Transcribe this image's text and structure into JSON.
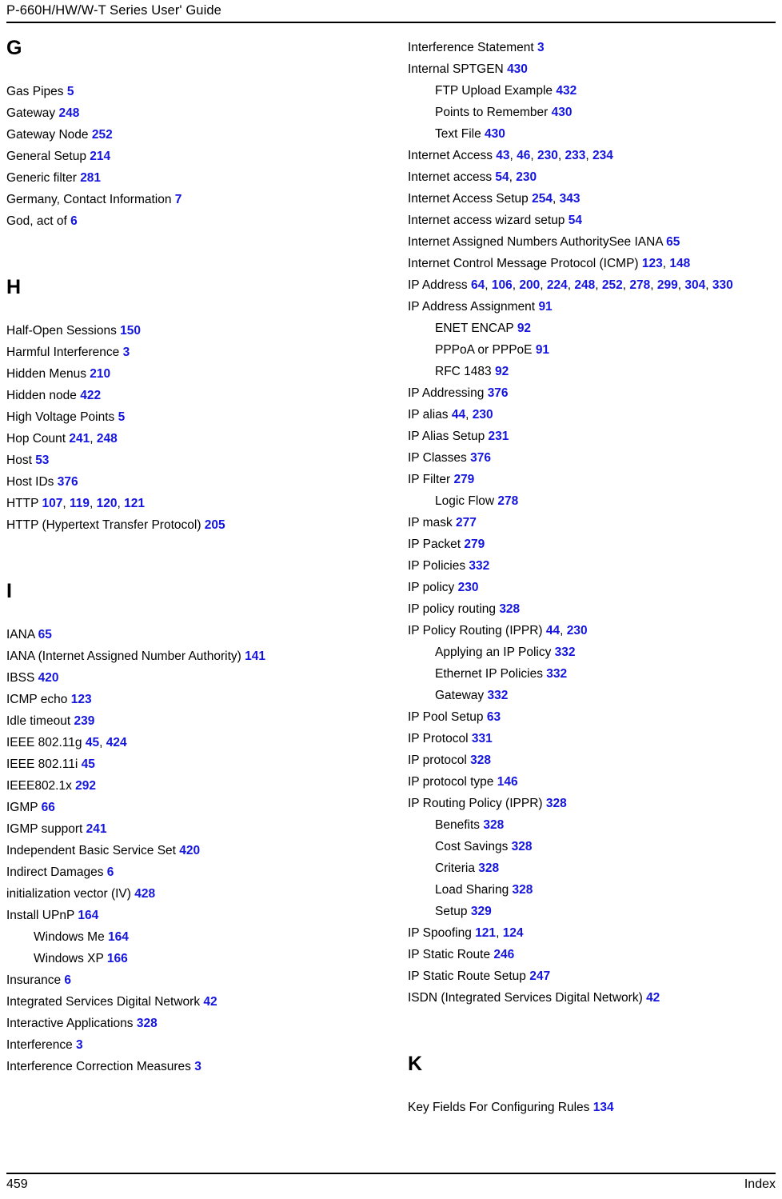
{
  "header": {
    "title": "P-660H/HW/W-T Series User' Guide"
  },
  "footer": {
    "page_number": "459",
    "section_label": "Index"
  },
  "colors": {
    "page_link": "#1515E0",
    "text": "#000000",
    "background": "#ffffff"
  },
  "columns": {
    "left": {
      "sections": [
        {
          "heading": "G",
          "entries": [
            {
              "label": "Gas Pipes",
              "pages": [
                "5"
              ],
              "level": 0
            },
            {
              "label": "Gateway",
              "pages": [
                "248"
              ],
              "level": 0
            },
            {
              "label": "Gateway Node",
              "pages": [
                "252"
              ],
              "level": 0
            },
            {
              "label": "General Setup",
              "pages": [
                "214"
              ],
              "level": 0
            },
            {
              "label": "Generic filter",
              "pages": [
                "281"
              ],
              "level": 0
            },
            {
              "label": "Germany, Contact Information",
              "pages": [
                "7"
              ],
              "level": 0
            },
            {
              "label": "God, act of",
              "pages": [
                "6"
              ],
              "level": 0
            }
          ]
        },
        {
          "heading": "H",
          "entries": [
            {
              "label": "Half-Open Sessions",
              "pages": [
                "150"
              ],
              "level": 0
            },
            {
              "label": "Harmful Interference",
              "pages": [
                "3"
              ],
              "level": 0
            },
            {
              "label": "Hidden Menus",
              "pages": [
                "210"
              ],
              "level": 0
            },
            {
              "label": "Hidden node",
              "pages": [
                "422"
              ],
              "level": 0
            },
            {
              "label": "High Voltage Points",
              "pages": [
                "5"
              ],
              "level": 0
            },
            {
              "label": "Hop Count",
              "pages": [
                "241",
                "248"
              ],
              "level": 0
            },
            {
              "label": "Host",
              "pages": [
                "53"
              ],
              "level": 0
            },
            {
              "label": "Host IDs",
              "pages": [
                "376"
              ],
              "level": 0
            },
            {
              "label": "HTTP",
              "pages": [
                "107",
                "119",
                "120",
                "121"
              ],
              "level": 0
            },
            {
              "label": "HTTP (Hypertext Transfer Protocol)",
              "pages": [
                "205"
              ],
              "level": 0
            }
          ]
        },
        {
          "heading": "I",
          "entries": [
            {
              "label": "IANA",
              "pages": [
                "65"
              ],
              "level": 0
            },
            {
              "label": "IANA (Internet Assigned Number Authority)",
              "pages": [
                "141"
              ],
              "level": 0
            },
            {
              "label": "IBSS",
              "pages": [
                "420"
              ],
              "level": 0
            },
            {
              "label": "ICMP echo",
              "pages": [
                "123"
              ],
              "level": 0
            },
            {
              "label": "Idle timeout",
              "pages": [
                "239"
              ],
              "level": 0
            },
            {
              "label": "IEEE 802.11g",
              "pages": [
                "45",
                "424"
              ],
              "level": 0
            },
            {
              "label": "IEEE 802.11i",
              "pages": [
                "45"
              ],
              "level": 0
            },
            {
              "label": "IEEE802.1x",
              "pages": [
                "292"
              ],
              "level": 0
            },
            {
              "label": "IGMP",
              "pages": [
                "66"
              ],
              "level": 0
            },
            {
              "label": "IGMP support",
              "pages": [
                "241"
              ],
              "level": 0
            },
            {
              "label": "Independent Basic Service Set",
              "pages": [
                "420"
              ],
              "level": 0
            },
            {
              "label": "Indirect Damages",
              "pages": [
                "6"
              ],
              "level": 0
            },
            {
              "label": "initialization vector (IV)",
              "pages": [
                "428"
              ],
              "level": 0
            },
            {
              "label": "Install UPnP",
              "pages": [
                "164"
              ],
              "level": 0
            },
            {
              "label": "Windows Me",
              "pages": [
                "164"
              ],
              "level": 1
            },
            {
              "label": "Windows XP",
              "pages": [
                "166"
              ],
              "level": 1
            },
            {
              "label": "Insurance",
              "pages": [
                "6"
              ],
              "level": 0
            },
            {
              "label": "Integrated Services Digital Network",
              "pages": [
                "42"
              ],
              "level": 0
            },
            {
              "label": "Interactive Applications",
              "pages": [
                "328"
              ],
              "level": 0
            },
            {
              "label": "Interference",
              "pages": [
                "3"
              ],
              "level": 0
            },
            {
              "label": "Interference Correction Measures",
              "pages": [
                "3"
              ],
              "level": 0
            }
          ]
        }
      ]
    },
    "right": {
      "sections": [
        {
          "heading": null,
          "entries": [
            {
              "label": "Interference Statement",
              "pages": [
                "3"
              ],
              "level": 0
            },
            {
              "label": "Internal SPTGEN",
              "pages": [
                "430"
              ],
              "level": 0
            },
            {
              "label": "FTP Upload Example",
              "pages": [
                "432"
              ],
              "level": 1
            },
            {
              "label": "Points to Remember",
              "pages": [
                "430"
              ],
              "level": 1
            },
            {
              "label": "Text File",
              "pages": [
                "430"
              ],
              "level": 1
            },
            {
              "label": "Internet Access",
              "pages": [
                "43",
                "46",
                "230",
                "233",
                "234"
              ],
              "level": 0
            },
            {
              "label": "Internet access",
              "pages": [
                "54",
                "230"
              ],
              "level": 0
            },
            {
              "label": "Internet Access Setup",
              "pages": [
                "254",
                "343"
              ],
              "level": 0
            },
            {
              "label": "Internet access wizard setup",
              "pages": [
                "54"
              ],
              "level": 0
            },
            {
              "label": "Internet Assigned Numbers AuthoritySee IANA",
              "pages": [
                "65"
              ],
              "level": 0
            },
            {
              "label": "Internet Control Message Protocol (ICMP)",
              "pages": [
                "123",
                "148"
              ],
              "level": 0
            },
            {
              "label": "IP Address",
              "pages": [
                "64",
                "106",
                "200",
                "224",
                "248",
                "252",
                "278",
                "299",
                "304",
                "330"
              ],
              "level": 0
            },
            {
              "label": "IP Address Assignment",
              "pages": [
                "91"
              ],
              "level": 0
            },
            {
              "label": "ENET ENCAP",
              "pages": [
                "92"
              ],
              "level": 1
            },
            {
              "label": "PPPoA or PPPoE",
              "pages": [
                "91"
              ],
              "level": 1
            },
            {
              "label": "RFC 1483",
              "pages": [
                "92"
              ],
              "level": 1
            },
            {
              "label": "IP Addressing",
              "pages": [
                "376"
              ],
              "level": 0
            },
            {
              "label": "IP alias",
              "pages": [
                "44",
                "230"
              ],
              "level": 0
            },
            {
              "label": "IP Alias Setup",
              "pages": [
                "231"
              ],
              "level": 0
            },
            {
              "label": "IP Classes",
              "pages": [
                "376"
              ],
              "level": 0
            },
            {
              "label": "IP Filter",
              "pages": [
                "279"
              ],
              "level": 0
            },
            {
              "label": "Logic Flow",
              "pages": [
                "278"
              ],
              "level": 1
            },
            {
              "label": "IP mask",
              "pages": [
                "277"
              ],
              "level": 0
            },
            {
              "label": "IP Packet",
              "pages": [
                "279"
              ],
              "level": 0
            },
            {
              "label": "IP Policies",
              "pages": [
                "332"
              ],
              "level": 0
            },
            {
              "label": "IP policy",
              "pages": [
                "230"
              ],
              "level": 0
            },
            {
              "label": "IP policy routing",
              "pages": [
                "328"
              ],
              "level": 0
            },
            {
              "label": "IP Policy Routing (IPPR)",
              "pages": [
                "44",
                "230"
              ],
              "level": 0
            },
            {
              "label": "Applying an IP Policy",
              "pages": [
                "332"
              ],
              "level": 1
            },
            {
              "label": "Ethernet IP Policies",
              "pages": [
                "332"
              ],
              "level": 1
            },
            {
              "label": "Gateway",
              "pages": [
                "332"
              ],
              "level": 1
            },
            {
              "label": "IP Pool Setup",
              "pages": [
                "63"
              ],
              "level": 0
            },
            {
              "label": "IP Protocol",
              "pages": [
                "331"
              ],
              "level": 0
            },
            {
              "label": "IP protocol",
              "pages": [
                "328"
              ],
              "level": 0
            },
            {
              "label": "IP protocol type",
              "pages": [
                "146"
              ],
              "level": 0
            },
            {
              "label": "IP Routing Policy (IPPR)",
              "pages": [
                "328"
              ],
              "level": 0
            },
            {
              "label": "Benefits",
              "pages": [
                "328"
              ],
              "level": 1
            },
            {
              "label": "Cost Savings",
              "pages": [
                "328"
              ],
              "level": 1
            },
            {
              "label": "Criteria",
              "pages": [
                "328"
              ],
              "level": 1
            },
            {
              "label": "Load Sharing",
              "pages": [
                "328"
              ],
              "level": 1
            },
            {
              "label": "Setup",
              "pages": [
                "329"
              ],
              "level": 1
            },
            {
              "label": "IP Spoofing",
              "pages": [
                "121",
                "124"
              ],
              "level": 0
            },
            {
              "label": "IP Static Route",
              "pages": [
                "246"
              ],
              "level": 0
            },
            {
              "label": "IP Static Route Setup",
              "pages": [
                "247"
              ],
              "level": 0
            },
            {
              "label": "ISDN (Integrated Services Digital Network)",
              "pages": [
                "42"
              ],
              "level": 0
            }
          ]
        },
        {
          "heading": "K",
          "entries": [
            {
              "label": "Key Fields For Configuring Rules",
              "pages": [
                "134"
              ],
              "level": 0
            }
          ]
        }
      ]
    }
  }
}
